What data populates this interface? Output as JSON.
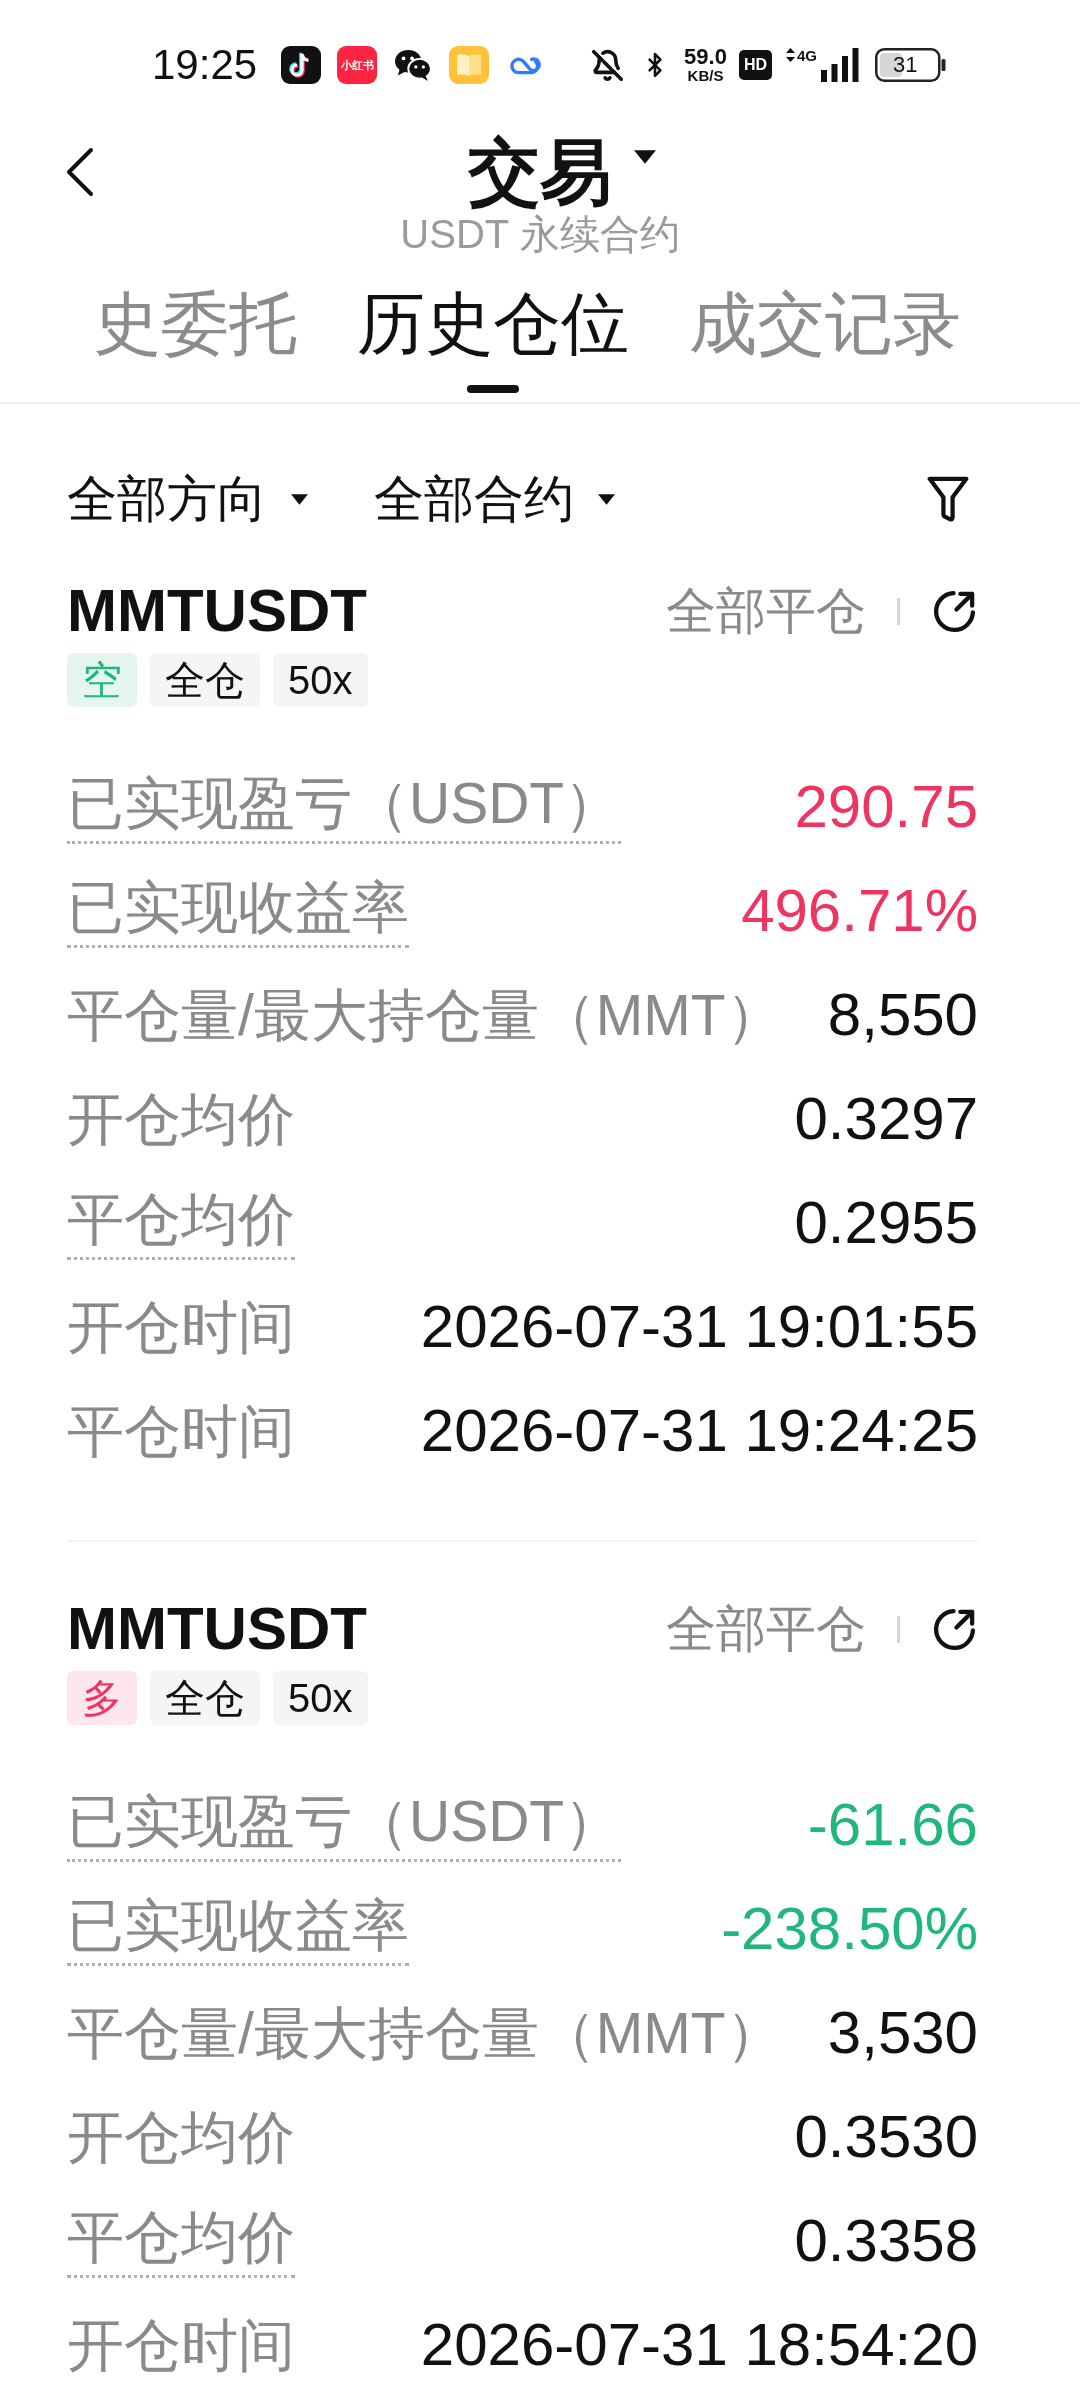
{
  "status_bar": {
    "time": "19:25",
    "app_icon_text": "小红书",
    "speed": "59.0",
    "speed_unit": "KB/S",
    "hd": "HD",
    "network": "4G",
    "battery": "31"
  },
  "header": {
    "title": "交易",
    "subtitle": "USDT 永续合约"
  },
  "tabs": [
    {
      "label": "史委托",
      "selected": false
    },
    {
      "label": "历史仓位",
      "selected": true
    },
    {
      "label": "成交记录",
      "selected": false
    }
  ],
  "filters": [
    {
      "label": "全部方向"
    },
    {
      "label": "全部合约"
    }
  ],
  "positions": [
    {
      "symbol": "MMTUSDT",
      "close_all": "全部平仓",
      "tags": [
        {
          "kind": "direction",
          "label": "空",
          "color": "#1fb77a"
        },
        {
          "kind": "plain",
          "label": "全仓"
        },
        {
          "kind": "plain",
          "label": "50x"
        }
      ],
      "fields": [
        {
          "label": "已实现盈亏（USDT）",
          "value": "290.75",
          "color": "#ee3560",
          "underlined": true
        },
        {
          "label": "已实现收益率",
          "value": "496.71%",
          "color": "#ee3560",
          "underlined": true
        },
        {
          "label": "平仓量/最大持仓量（MMT）",
          "value": "8,550",
          "color": "#111111",
          "underlined": false
        },
        {
          "label": "开仓均价",
          "value": "0.3297",
          "color": "#111111",
          "underlined": false
        },
        {
          "label": "平仓均价",
          "value": "0.2955",
          "color": "#111111",
          "underlined": true
        },
        {
          "label": "开仓时间",
          "value": "2026-07-31 19:01:55",
          "color": "#111111",
          "underlined": false
        },
        {
          "label": "平仓时间",
          "value": "2026-07-31 19:24:25",
          "color": "#111111",
          "underlined": false
        }
      ]
    },
    {
      "symbol": "MMTUSDT",
      "close_all": "全部平仓",
      "tags": [
        {
          "kind": "direction",
          "label": "多",
          "color": "#ee3560"
        },
        {
          "kind": "plain",
          "label": "全仓"
        },
        {
          "kind": "plain",
          "label": "50x"
        }
      ],
      "fields": [
        {
          "label": "已实现盈亏（USDT）",
          "value": "-61.66",
          "color": "#1fb77a",
          "underlined": true
        },
        {
          "label": "已实现收益率",
          "value": "-238.50%",
          "color": "#1fb77a",
          "underlined": true
        },
        {
          "label": "平仓量/最大持仓量（MMT）",
          "value": "3,530",
          "color": "#111111",
          "underlined": false
        },
        {
          "label": "开仓均价",
          "value": "0.3530",
          "color": "#111111",
          "underlined": false
        },
        {
          "label": "平仓均价",
          "value": "0.3358",
          "color": "#111111",
          "underlined": true
        },
        {
          "label": "开仓时间",
          "value": "2026-07-31 18:54:20",
          "color": "#111111",
          "underlined": false
        }
      ]
    }
  ]
}
